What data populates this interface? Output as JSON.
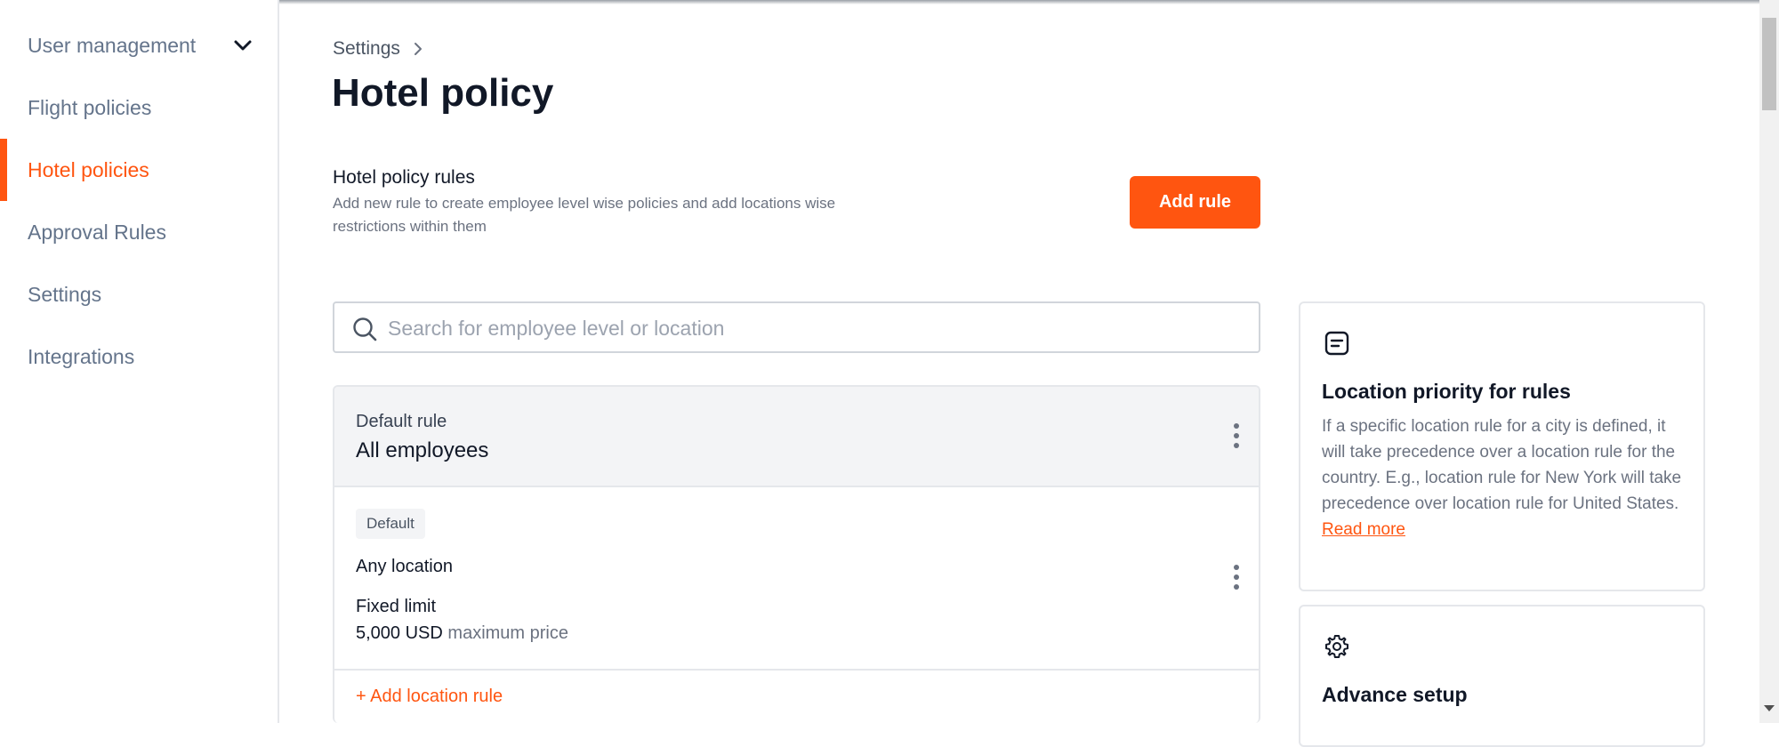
{
  "sidebar": {
    "items": [
      {
        "label": "User management",
        "active": false,
        "has_chevron": true
      },
      {
        "label": "Flight policies",
        "active": false
      },
      {
        "label": "Hotel policies",
        "active": true
      },
      {
        "label": "Approval Rules",
        "active": false
      },
      {
        "label": "Settings",
        "active": false
      },
      {
        "label": "Integrations",
        "active": false
      }
    ]
  },
  "header": {
    "breadcrumb": "Settings",
    "title": "Hotel policy"
  },
  "rules_section": {
    "heading": "Hotel policy rules",
    "description": "Add new rule to create employee level wise policies and add locations wise restrictions within them",
    "add_rule_label": "Add rule"
  },
  "search": {
    "placeholder": "Search for employee level or location",
    "value": ""
  },
  "default_rule": {
    "label": "Default rule",
    "value": "All employees",
    "badge": "Default",
    "location": "Any location",
    "limit_type": "Fixed limit",
    "limit_amount": "5,000 USD",
    "limit_suffix": "maximum price",
    "add_location_rule": "+ Add location rule"
  },
  "info_cards": {
    "priority": {
      "title": "Location priority for rules",
      "body": "If a specific location rule for a city is defined, it will take precedence over a location rule for the country. E.g., location rule for New York will take precedence over location rule for United States.",
      "link": "Read more"
    },
    "advance": {
      "title": "Advance setup"
    }
  },
  "colors": {
    "accent": "#ff5510",
    "muted_text": "#64748b",
    "border": "#e5e7eb"
  }
}
